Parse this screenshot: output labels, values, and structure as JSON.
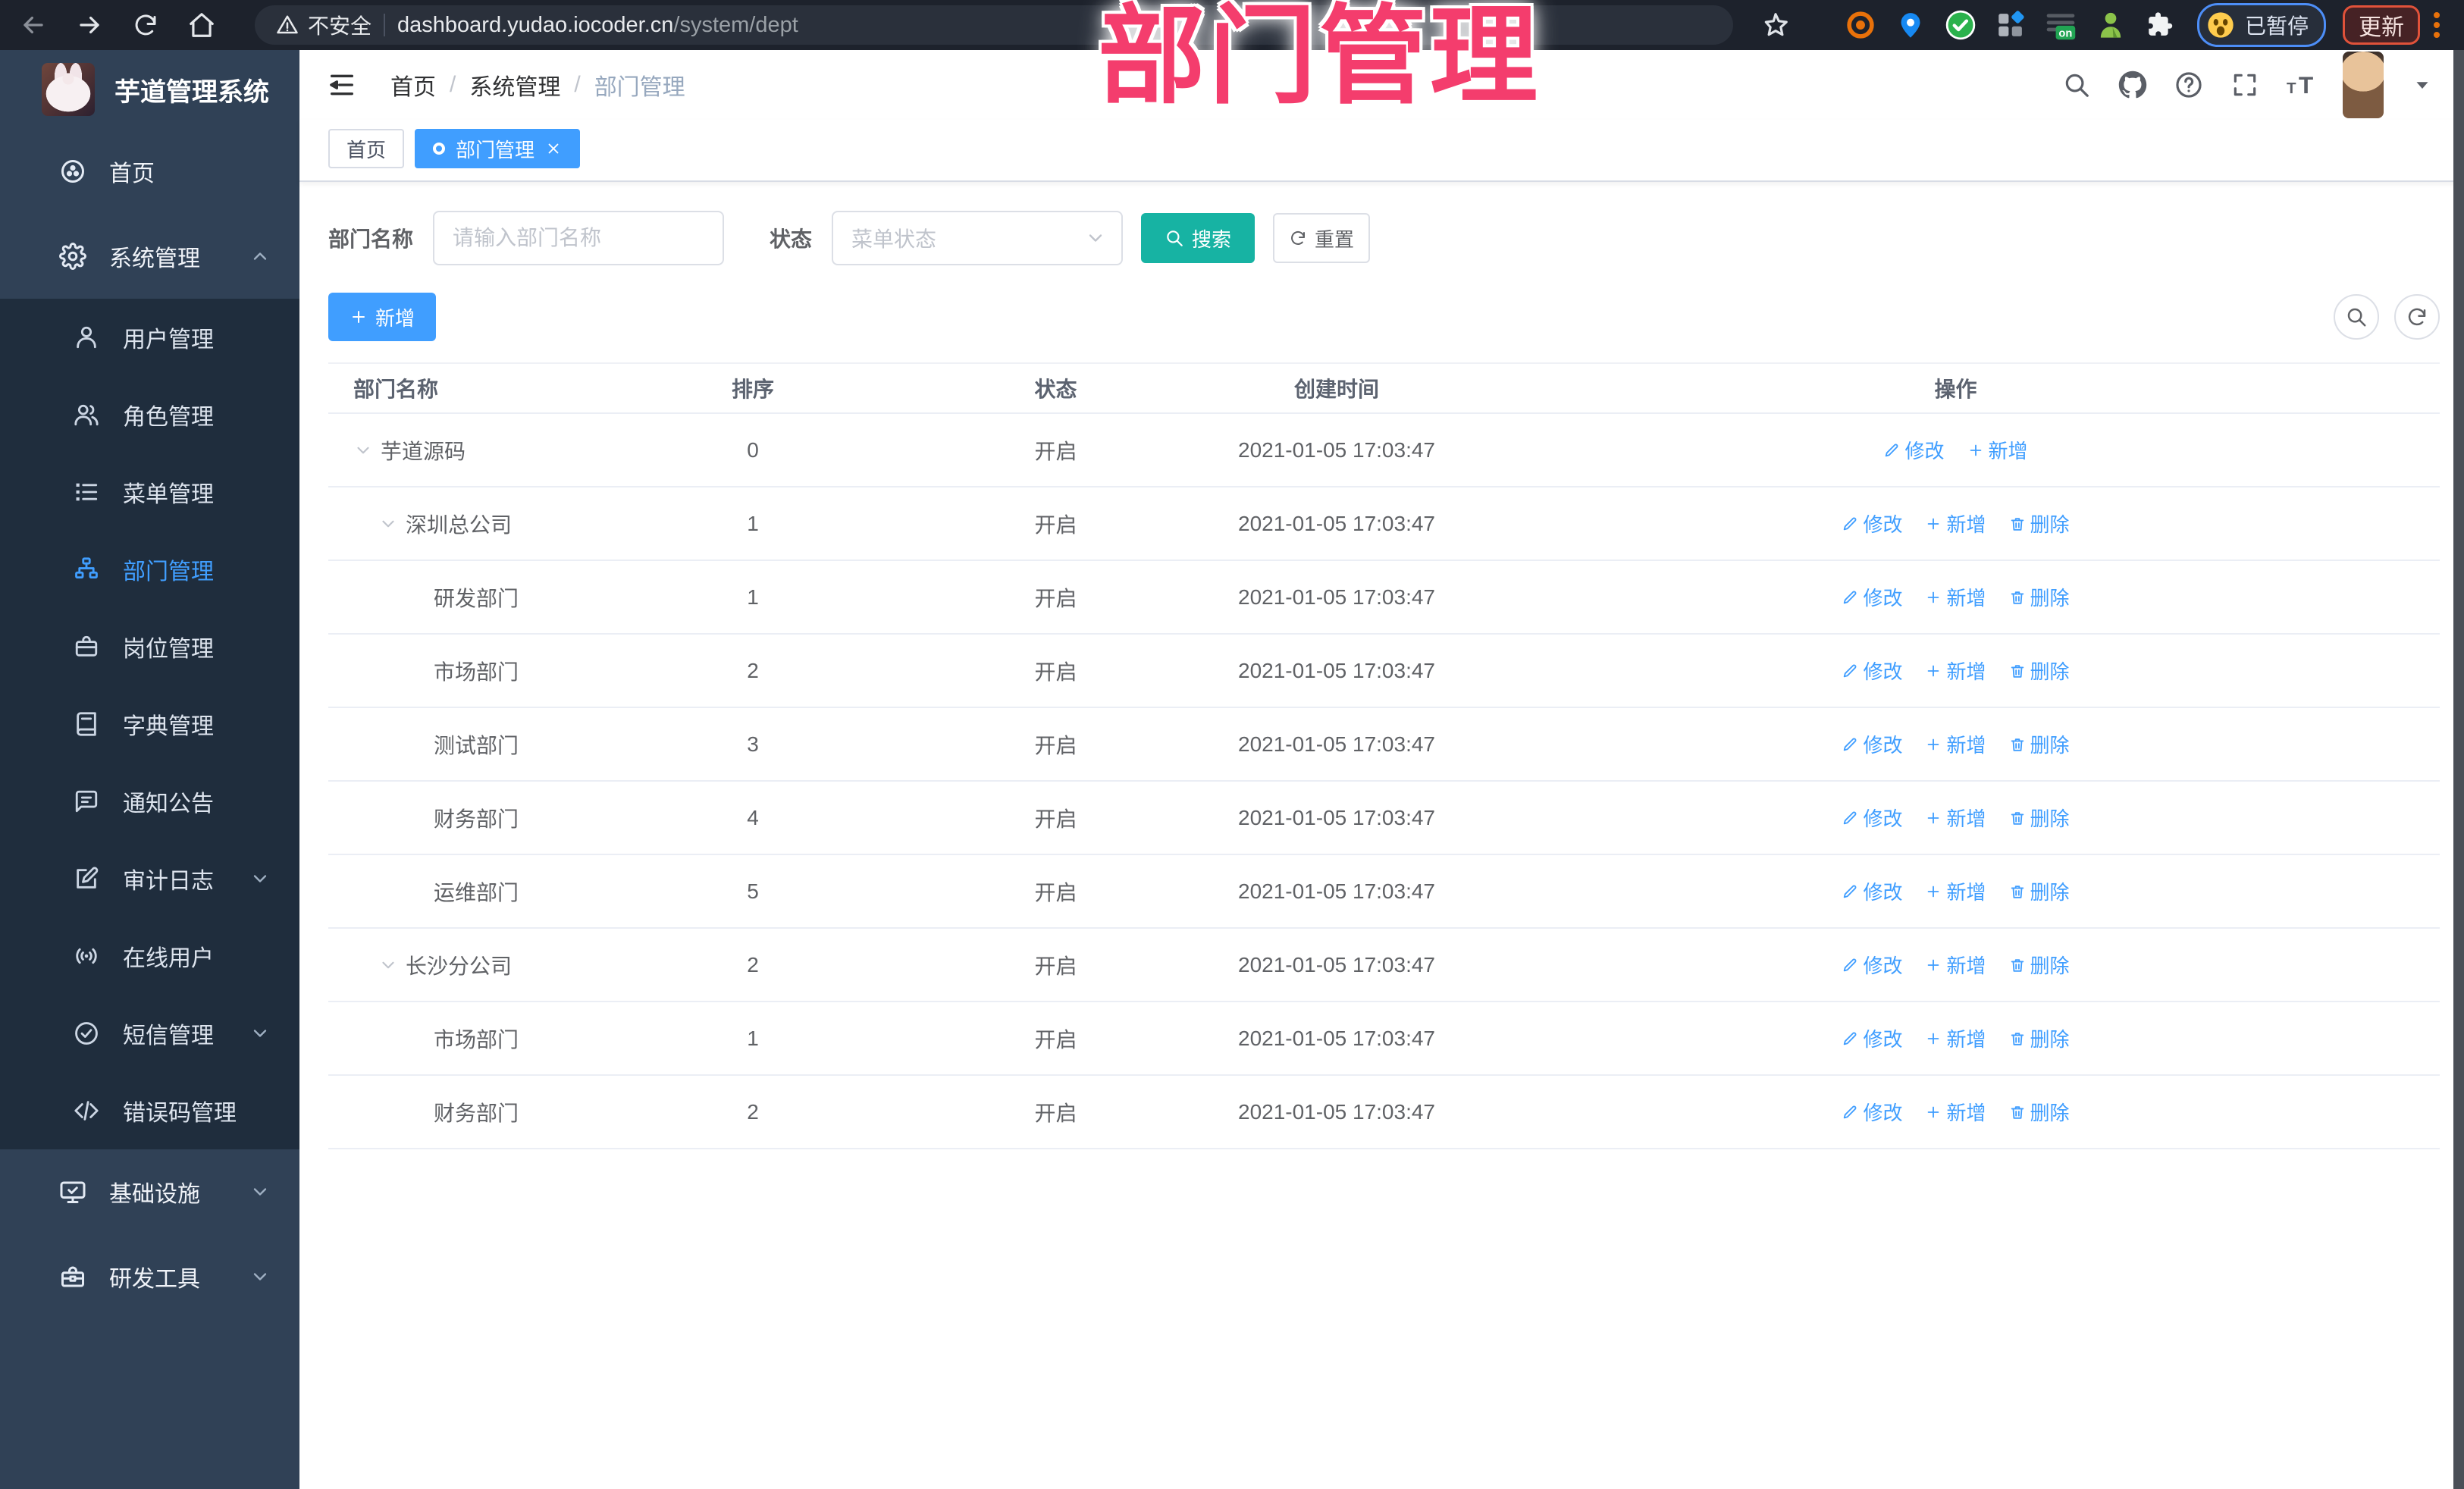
{
  "browser": {
    "security_label": "不安全",
    "url_domain": "dashboard.yudao.iocoder.cn",
    "url_path": "/system/dept",
    "paused_label": "已暂停",
    "update_label": "更新",
    "ext_on_label": "on",
    "extensions": [
      "target",
      "pin",
      "check-circle",
      "grid",
      "lines-on",
      "person",
      "puzzle"
    ]
  },
  "annotation": {
    "text": "部门管理",
    "color": "#f43d6d"
  },
  "sidebar": {
    "title": "芋道管理系统",
    "items": [
      {
        "key": "home",
        "label": "首页",
        "icon": "compass",
        "type": "parent"
      },
      {
        "key": "system-management",
        "label": "系统管理",
        "icon": "gear",
        "type": "parent",
        "chevron": "up"
      },
      {
        "key": "user-management",
        "label": "用户管理",
        "icon": "user",
        "type": "child"
      },
      {
        "key": "role-management",
        "label": "角色管理",
        "icon": "users",
        "type": "child"
      },
      {
        "key": "menu-management",
        "label": "菜单管理",
        "icon": "menu-list",
        "type": "child"
      },
      {
        "key": "dept-management",
        "label": "部门管理",
        "icon": "org-tree",
        "type": "child",
        "active": true
      },
      {
        "key": "post-management",
        "label": "岗位管理",
        "icon": "briefcase",
        "type": "child"
      },
      {
        "key": "dict-management",
        "label": "字典管理",
        "icon": "book",
        "type": "child"
      },
      {
        "key": "notice",
        "label": "通知公告",
        "icon": "notice",
        "type": "child"
      },
      {
        "key": "audit-log",
        "label": "审计日志",
        "icon": "log",
        "type": "child",
        "chevron": "down"
      },
      {
        "key": "online-user",
        "label": "在线用户",
        "icon": "online",
        "type": "child"
      },
      {
        "key": "sms-management",
        "label": "短信管理",
        "icon": "sms",
        "type": "child",
        "chevron": "down"
      },
      {
        "key": "error-code-management",
        "label": "错误码管理",
        "icon": "code",
        "type": "child"
      },
      {
        "key": "infrastructure",
        "label": "基础设施",
        "icon": "monitor",
        "type": "parent",
        "chevron": "down"
      },
      {
        "key": "dev-tools",
        "label": "研发工具",
        "icon": "toolbox",
        "type": "parent",
        "chevron": "down"
      }
    ]
  },
  "navbar": {
    "breadcrumb": [
      "首页",
      "系统管理",
      "部门管理"
    ],
    "breadcrumb_separator": "/",
    "icons": [
      "search",
      "github",
      "question",
      "fullscreen",
      "fontsize"
    ]
  },
  "tabs": [
    {
      "key": "home",
      "label": "首页"
    },
    {
      "key": "dept",
      "label": "部门管理",
      "active": true,
      "closable": true
    }
  ],
  "filters": {
    "name_label": "部门名称",
    "name_placeholder": "请输入部门名称",
    "status_label": "状态",
    "status_placeholder": "菜单状态",
    "search_label": "搜索",
    "reset_label": "重置"
  },
  "toolbar": {
    "add_label": "新增"
  },
  "table": {
    "columns": [
      "部门名称",
      "排序",
      "状态",
      "创建时间",
      "操作"
    ],
    "action_labels": {
      "edit": "修改",
      "add": "新增",
      "delete": "删除"
    },
    "rows": [
      {
        "name": "芋道源码",
        "level": 0,
        "expandable": true,
        "sort": "0",
        "status": "开启",
        "created": "2021-01-05 17:03:47",
        "actions": [
          "edit",
          "add"
        ]
      },
      {
        "name": "深圳总公司",
        "level": 1,
        "expandable": true,
        "sort": "1",
        "status": "开启",
        "created": "2021-01-05 17:03:47",
        "actions": [
          "edit",
          "add",
          "delete"
        ]
      },
      {
        "name": "研发部门",
        "level": 2,
        "expandable": false,
        "sort": "1",
        "status": "开启",
        "created": "2021-01-05 17:03:47",
        "actions": [
          "edit",
          "add",
          "delete"
        ]
      },
      {
        "name": "市场部门",
        "level": 2,
        "expandable": false,
        "sort": "2",
        "status": "开启",
        "created": "2021-01-05 17:03:47",
        "actions": [
          "edit",
          "add",
          "delete"
        ]
      },
      {
        "name": "测试部门",
        "level": 2,
        "expandable": false,
        "sort": "3",
        "status": "开启",
        "created": "2021-01-05 17:03:47",
        "actions": [
          "edit",
          "add",
          "delete"
        ]
      },
      {
        "name": "财务部门",
        "level": 2,
        "expandable": false,
        "sort": "4",
        "status": "开启",
        "created": "2021-01-05 17:03:47",
        "actions": [
          "edit",
          "add",
          "delete"
        ]
      },
      {
        "name": "运维部门",
        "level": 2,
        "expandable": false,
        "sort": "5",
        "status": "开启",
        "created": "2021-01-05 17:03:47",
        "actions": [
          "edit",
          "add",
          "delete"
        ]
      },
      {
        "name": "长沙分公司",
        "level": 1,
        "expandable": true,
        "sort": "2",
        "status": "开启",
        "created": "2021-01-05 17:03:47",
        "actions": [
          "edit",
          "add",
          "delete"
        ]
      },
      {
        "name": "市场部门",
        "level": 2,
        "expandable": false,
        "sort": "1",
        "status": "开启",
        "created": "2021-01-05 17:03:47",
        "actions": [
          "edit",
          "add",
          "delete"
        ]
      },
      {
        "name": "财务部门",
        "level": 2,
        "expandable": false,
        "sort": "2",
        "status": "开启",
        "created": "2021-01-05 17:03:47",
        "actions": [
          "edit",
          "add",
          "delete"
        ]
      }
    ]
  },
  "colors": {
    "accent": "#409eff",
    "search_teal": "#17b3a3",
    "sidebar_bg": "#304156",
    "submenu_bg": "#1f2d3d",
    "annotation_pink": "#f43d6d",
    "browser_bar": "#1d222c"
  }
}
